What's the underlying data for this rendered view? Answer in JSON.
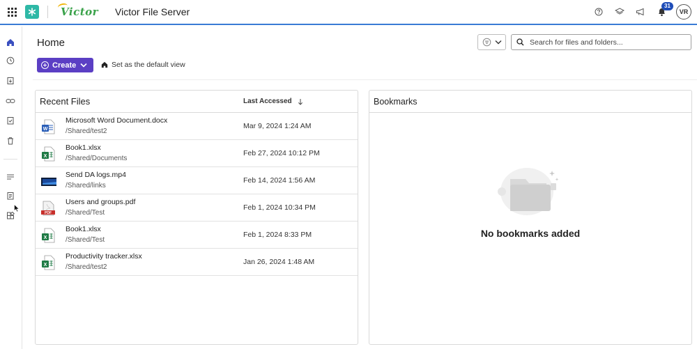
{
  "app": {
    "title": "Victor File Server",
    "logo_text": "Victor"
  },
  "topbar": {
    "icons": [
      "help-icon",
      "layers-icon",
      "megaphone-icon",
      "bell-icon"
    ],
    "notifications_count": "31",
    "avatar_initials": "VR"
  },
  "rail": {
    "items": [
      "home-icon",
      "recent-icon",
      "shared-icon",
      "link-icon",
      "tasks-icon",
      "trash-icon",
      "filters-icon",
      "reports-icon",
      "apps-icon"
    ]
  },
  "page": {
    "title": "Home",
    "create_label": "Create",
    "default_view_label": "Set as the default view",
    "search_placeholder": "Search for files and folders..."
  },
  "recent_files": {
    "title": "Recent Files",
    "column_last_accessed": "Last Accessed",
    "files": [
      {
        "name": "Microsoft Word Document.docx",
        "path": "/Shared/test2",
        "date": "Mar 9, 2024 1:24 AM",
        "type": "word"
      },
      {
        "name": "Book1.xlsx",
        "path": "/Shared/Documents",
        "date": "Feb 27, 2024 10:12 PM",
        "type": "excel"
      },
      {
        "name": "Send DA logs.mp4",
        "path": "/Shared/links",
        "date": "Feb 14, 2024 1:56 AM",
        "type": "video"
      },
      {
        "name": "Users and groups.pdf",
        "path": "/Shared/Test",
        "date": "Feb 1, 2024 10:34 PM",
        "type": "pdf"
      },
      {
        "name": "Book1.xlsx",
        "path": "/Shared/Test",
        "date": "Feb 1, 2024 8:33 PM",
        "type": "excel"
      },
      {
        "name": "Productivity tracker.xlsx",
        "path": "/Shared/test2",
        "date": "Jan 26, 2024 1:48 AM",
        "type": "excel"
      }
    ]
  },
  "bookmarks": {
    "title": "Bookmarks",
    "empty_text": "No bookmarks added"
  },
  "colors": {
    "accent_purple": "#5b3fc4",
    "topbar_rule": "#3a7bd5",
    "brand_teal": "#2eb8a6",
    "badge_blue": "#1f4db8"
  }
}
